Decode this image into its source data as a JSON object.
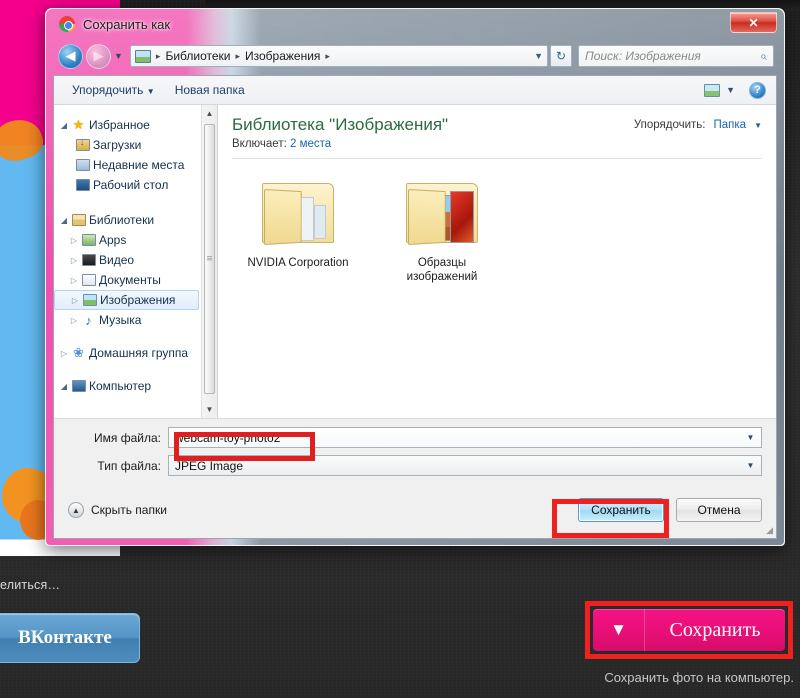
{
  "background_page": {
    "share_label": "елиться…",
    "vk_button": "ВКонтакте",
    "pink_save_button": "Сохранить",
    "pink_save_caption": "Сохранить фото на компьютер.",
    "chevron_icon": "▼",
    "colors": {
      "pink": "#e8127c",
      "vk_blue": "#5595c6",
      "highlight_red": "#ee2020"
    }
  },
  "dialog": {
    "title": "Сохранить как",
    "app_icon": "chrome-icon",
    "close_label": "✕",
    "nav": {
      "back_icon": "◀",
      "forward_icon": "▶",
      "history_caret": "▼",
      "breadcrumbs": [
        "Библиотеки",
        "Изображения"
      ],
      "separator": "▸",
      "dropdown_caret": "▼",
      "refresh_icon": "↻"
    },
    "search": {
      "placeholder": "Поиск: Изображения",
      "icon": "⌕"
    },
    "toolbar": {
      "organize": "Упорядочить",
      "organize_caret": "▼",
      "new_folder": "Новая папка",
      "view_caret": "▼",
      "help_label": "?"
    },
    "sidebar": {
      "groups": [
        {
          "label": "Избранное",
          "icon": "star-icon",
          "expanded": true,
          "items": [
            {
              "label": "Загрузки",
              "icon": "downloads-icon"
            },
            {
              "label": "Недавние места",
              "icon": "recent-places-icon"
            },
            {
              "label": "Рабочий стол",
              "icon": "desktop-icon"
            }
          ]
        },
        {
          "label": "Библиотеки",
          "icon": "libraries-icon",
          "expanded": true,
          "items": [
            {
              "label": "Apps",
              "icon": "apps-icon",
              "selected": false
            },
            {
              "label": "Видео",
              "icon": "video-icon",
              "selected": false
            },
            {
              "label": "Документы",
              "icon": "documents-icon",
              "selected": false
            },
            {
              "label": "Изображения",
              "icon": "pictures-icon",
              "selected": true
            },
            {
              "label": "Музыка",
              "icon": "music-icon",
              "selected": false
            }
          ]
        },
        {
          "label": "Домашняя группа",
          "icon": "homegroup-icon",
          "expanded": false,
          "items": []
        },
        {
          "label": "Компьютер",
          "icon": "computer-icon",
          "expanded": true,
          "items": []
        }
      ],
      "scroll_up": "▲",
      "scroll_down": "▼"
    },
    "content": {
      "library_title": "Библиотека \"Изображения\"",
      "includes_label": "Включает:",
      "includes_value": "2 места",
      "arrange_label": "Упорядочить:",
      "arrange_value": "Папка",
      "arrange_caret": "▼",
      "folders": [
        {
          "name": "NVIDIA Corporation",
          "type": "documents"
        },
        {
          "name": "Образцы изображений",
          "type": "pictures"
        }
      ]
    },
    "form": {
      "filename_label": "Имя файла:",
      "filename_value": "webcam-toy-photo2",
      "filetype_label": "Тип файла:",
      "filetype_value": "JPEG Image",
      "caret": "▼"
    },
    "footer": {
      "hide_folders": "Скрыть папки",
      "hide_icon": "▲",
      "save_button": "Сохранить",
      "cancel_button": "Отмена",
      "resize_grip": "◢"
    }
  }
}
